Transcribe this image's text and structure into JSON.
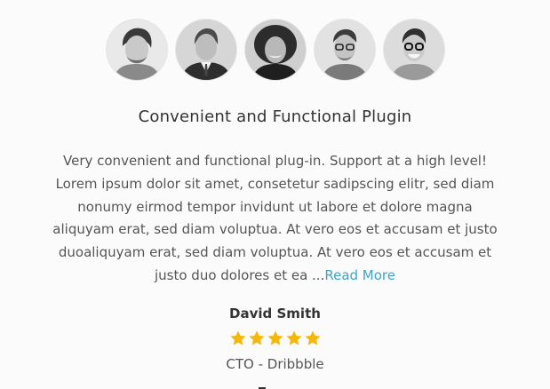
{
  "testimonial": {
    "title": "Convenient and Functional Plugin",
    "quote": "Very convenient and functional plug-in. Support at a high level! Lorem ipsum dolor sit amet, consetetur sadipscing elitr, sed diam nonumy eirmod tempor invidunt ut labore et dolore magna aliquyam erat, sed diam voluptua. At vero eos et accusam et justo duoaliquyam erat, sed diam voluptua. At vero eos et accusam et justo duo dolores et ea ...",
    "read_more_label": "Read More",
    "author_name": "David Smith",
    "rating": 5,
    "rating_max": 5,
    "author_role": "CTO - Dribbble"
  },
  "avatars": [
    {
      "icon": "avatar-1"
    },
    {
      "icon": "avatar-2"
    },
    {
      "icon": "avatar-3"
    },
    {
      "icon": "avatar-4"
    },
    {
      "icon": "avatar-5"
    }
  ],
  "colors": {
    "link": "#3fa4c7",
    "star": "#f5b70a",
    "text": "#555555",
    "heading": "#333333"
  }
}
